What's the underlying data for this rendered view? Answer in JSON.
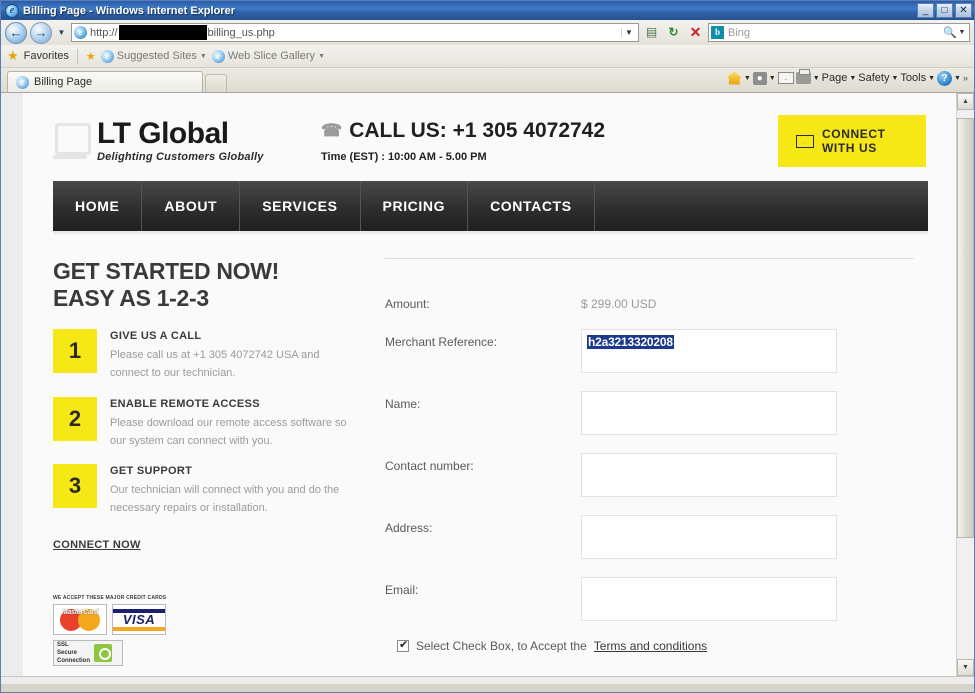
{
  "window": {
    "title": "Billing Page - Windows Internet Explorer",
    "ie_glyph": "e",
    "minimize": "_",
    "restore": "□",
    "close": "✕"
  },
  "browser": {
    "back_icon": "←",
    "forward_icon": "→",
    "history_caret": "▼",
    "url": {
      "protocol": "http://",
      "redacted": "",
      "path": "billing_us.php"
    },
    "url_caret": "▼",
    "compat_icon": "▤",
    "refresh_icon": "↻",
    "stop_icon": "✕",
    "search": {
      "provider_icon": "b",
      "placeholder": "Bing",
      "go_icon": "ὐd",
      "caret": "▼"
    },
    "favorites_bar": {
      "favorites_label": "Favorites",
      "suggested_sites": "Suggested Sites",
      "web_slice_gallery": "Web Slice Gallery",
      "caret": "▼"
    },
    "tab_label": "Billing Page",
    "command_bar": {
      "home": "Home",
      "feeds": "☉",
      "mail": "Mail",
      "print": "Print",
      "page": "Page",
      "safety": "Safety",
      "tools": "Tools",
      "help": "?",
      "overflow": "»",
      "caret": "▼"
    },
    "scrollbar": {
      "up_arrow": "▲",
      "down_arrow": "▼"
    }
  },
  "site": {
    "logo": {
      "name": "LT Global",
      "tagline": "Delighting Customers Globally"
    },
    "call": {
      "phone_icon": "☎",
      "headline": "CALL US: +1 305 4072742",
      "hours": "Time (EST) : 10:00 AM - 5.00 PM"
    },
    "connect_button": {
      "label": "CONNECT WITH US",
      "icon": "envelope-icon"
    },
    "nav": [
      {
        "label": "HOME"
      },
      {
        "label": "ABOUT"
      },
      {
        "label": "SERVICES"
      },
      {
        "label": "PRICING"
      },
      {
        "label": "CONTACTS"
      }
    ]
  },
  "get_started": {
    "title_line1": "GET STARTED NOW!",
    "title_line2": "EASY AS 1-2-3",
    "steps": [
      {
        "number": "1",
        "title": "GIVE US A CALL",
        "desc": "Please call us at +1 305 4072742 USA and connect to our technician."
      },
      {
        "number": "2",
        "title": "ENABLE REMOTE ACCESS",
        "desc": "Please download our remote access software so our system can connect with you."
      },
      {
        "number": "3",
        "title": "GET SUPPORT",
        "desc": "Our technician will connect with you and do the necessary repairs or installation."
      }
    ],
    "connect_now": "CONNECT NOW"
  },
  "payment_badges": {
    "caption": "WE ACCEPT THESE MAJOR CREDIT CARDS",
    "mastercard": "MasterCard",
    "visa": "VISA",
    "ssl_line1": "SSL",
    "ssl_line2": "Secure",
    "ssl_line3": "Connection"
  },
  "form": {
    "amount_label": "Amount:",
    "amount_value": "$ 299.00 USD",
    "merchant_label": "Merchant Reference:",
    "merchant_value": "h2a3213320208",
    "name_label": "Name:",
    "name_value": "",
    "contact_label": "Contact number:",
    "contact_value": "",
    "address_label": "Address:",
    "address_value": "",
    "email_label": "Email:",
    "email_value": "",
    "terms_text": "Select Check Box, to Accept the",
    "terms_link": "Terms and conditions",
    "terms_checked": true
  },
  "colors": {
    "accent_yellow": "#f5e816",
    "nav_dark": "#2e2e2e",
    "selection_blue": "#1b3a8c",
    "title_blue": "#2a5caa"
  }
}
